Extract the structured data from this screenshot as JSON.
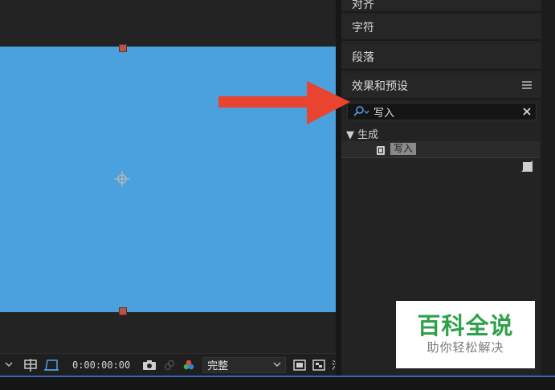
{
  "panels": {
    "sections": [
      {
        "label": "对齐"
      },
      {
        "label": "字符"
      },
      {
        "label": "段落"
      },
      {
        "label": "效果和预设"
      }
    ],
    "menu_icon": "hamburger-menu-icon"
  },
  "effects_search": {
    "value": "写入",
    "search_icon": "search-icon",
    "clear_icon": "close-icon"
  },
  "preset_tree": {
    "category": "▼ 生成",
    "item": "写入",
    "item_icon": "effect-preset-icon"
  },
  "viewer_toolbar": {
    "timecode": "0:00:00:00",
    "resolution": "完整",
    "icons": [
      "chevron-down-icon",
      "grid-icon",
      "region-of-interest-icon",
      "camera-icon",
      "link-icon",
      "color-channels-icon",
      "chevron-down-icon",
      "view-layout-icon",
      "transparency-grid-icon"
    ],
    "truncated_label": "活"
  },
  "composition": {
    "background_color": "#4aa1dd",
    "handle_color": "#b3564a"
  },
  "annotation": {
    "arrow_color": "#e8442f"
  },
  "watermark": {
    "title": "百科全说",
    "subtitle": "助你轻松解决",
    "title_color": "#2fa14a"
  }
}
